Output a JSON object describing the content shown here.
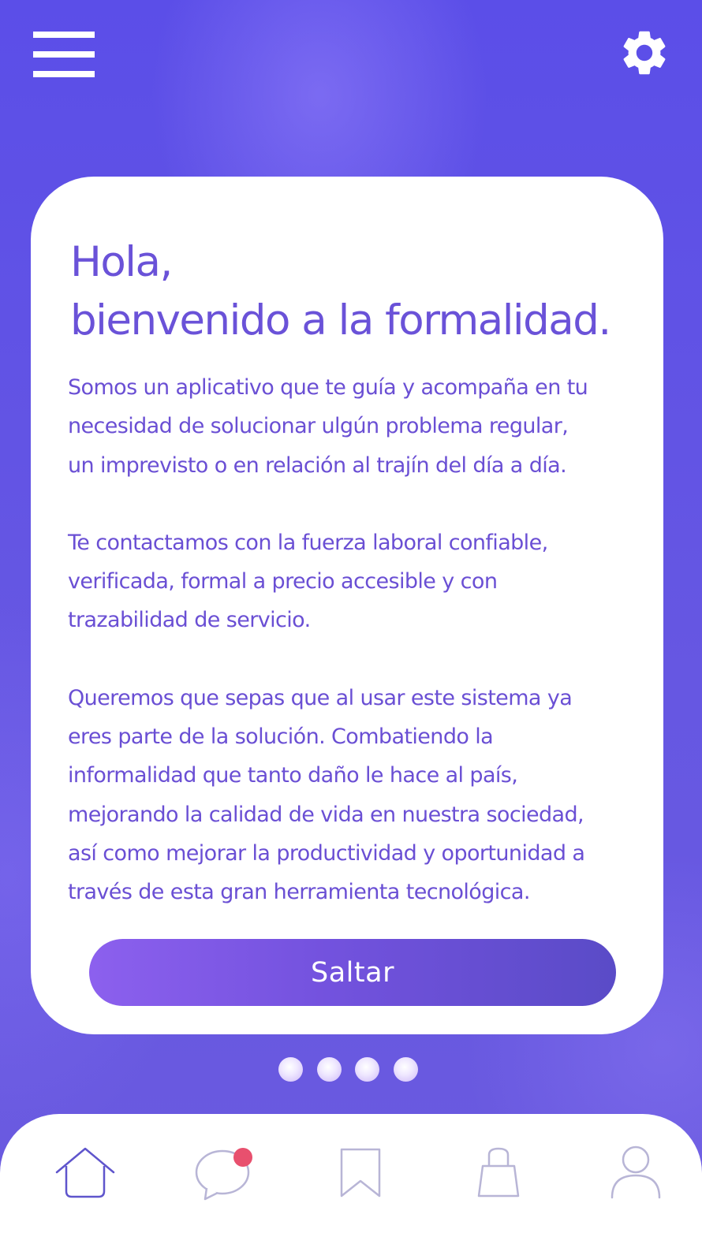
{
  "header": {
    "menu_icon": "hamburger-menu-icon",
    "settings_icon": "gear-icon"
  },
  "card": {
    "title_line1": "Hola,",
    "title_line2": "bienvenido a la formalidad.",
    "paragraphs": [
      "Somos un aplicativo que te guía y acompaña en tu\nnecesidad de solucionar ulgún problema regular,\nun imprevisto o en relación al trajín del día a día.",
      "Te contactamos con la fuerza laboral confiable,\nverificada, formal a precio accesible y con\ntrazabilidad de servicio.",
      "Queremos que sepas que al usar este sistema  ya\neres parte de la solución. Combatiendo la\ninformalidad que tanto daño le hace al país,\nmejorando la calidad de vida en nuestra sociedad,\nasí como mejorar la productividad y oportunidad a\ntravés de esta gran herramienta tecnológica."
    ],
    "skip_label": "Saltar"
  },
  "pagination": {
    "count": 4
  },
  "bottom_nav": {
    "items": [
      {
        "icon": "home-icon"
      },
      {
        "icon": "chat-icon",
        "badge": true
      },
      {
        "icon": "bookmark-icon"
      },
      {
        "icon": "shopping-bag-icon"
      },
      {
        "icon": "user-icon"
      }
    ]
  },
  "colors": {
    "background": "#5e52e6",
    "accent_text": "#6a52d8",
    "button_start": "#8c60ee",
    "button_end": "#5a4bc7",
    "badge": "#e8506e",
    "nav_icon_active": "#5f55cc",
    "nav_icon_inactive": "#b8b5d6"
  }
}
